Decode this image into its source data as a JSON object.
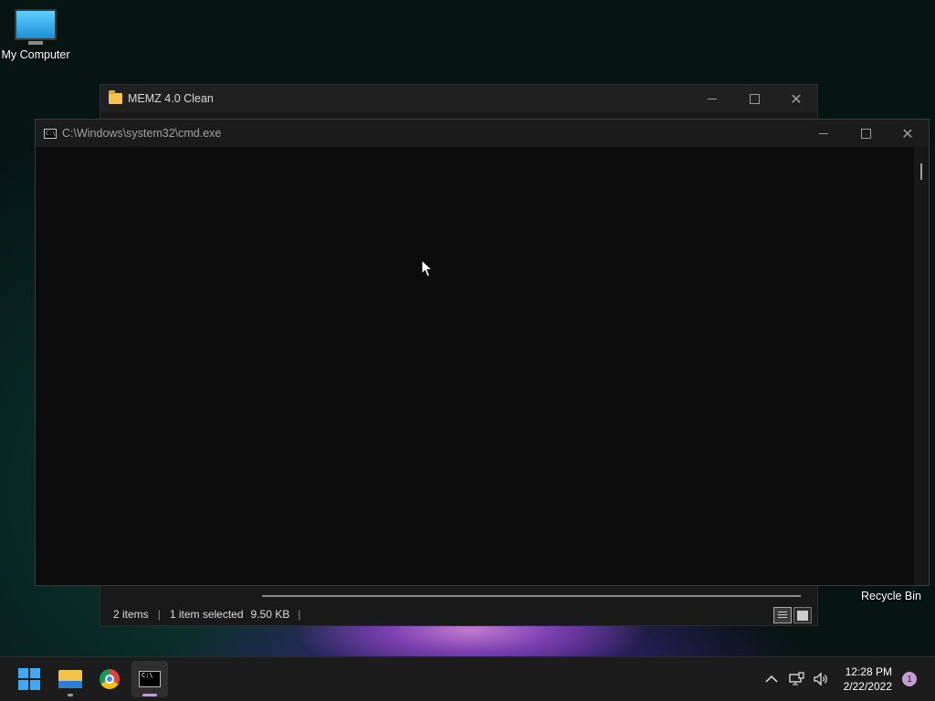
{
  "desktop": {
    "icons": [
      {
        "label": "My Computer",
        "icon": "monitor-icon"
      },
      {
        "label": "Recycle Bin",
        "icon": "recycle-bin-icon"
      }
    ]
  },
  "explorer_window": {
    "title": "MEMZ 4.0 Clean",
    "icon": "folder-icon",
    "status": {
      "items": "2 items",
      "separator": "|",
      "selected": "1 item selected",
      "size": "9.50 KB"
    }
  },
  "cmd_window": {
    "title": "C:\\Windows\\system32\\cmd.exe",
    "icon": "cmd-icon",
    "console_text": ""
  },
  "taskbar": {
    "apps": [
      {
        "name": "Start",
        "icon": "windows-start-icon"
      },
      {
        "name": "File Explorer",
        "icon": "file-explorer-icon",
        "running": true
      },
      {
        "name": "Google Chrome",
        "icon": "chrome-icon"
      },
      {
        "name": "Command Prompt",
        "icon": "terminal-icon",
        "active": true
      }
    ],
    "tray": {
      "time": "12:28 PM",
      "date": "2/22/2022",
      "notification_count": "1"
    }
  },
  "colors": {
    "accent": "#3fa9f5",
    "active_indicator": "#c79bd6",
    "notification_badge": "#c79bd6"
  }
}
